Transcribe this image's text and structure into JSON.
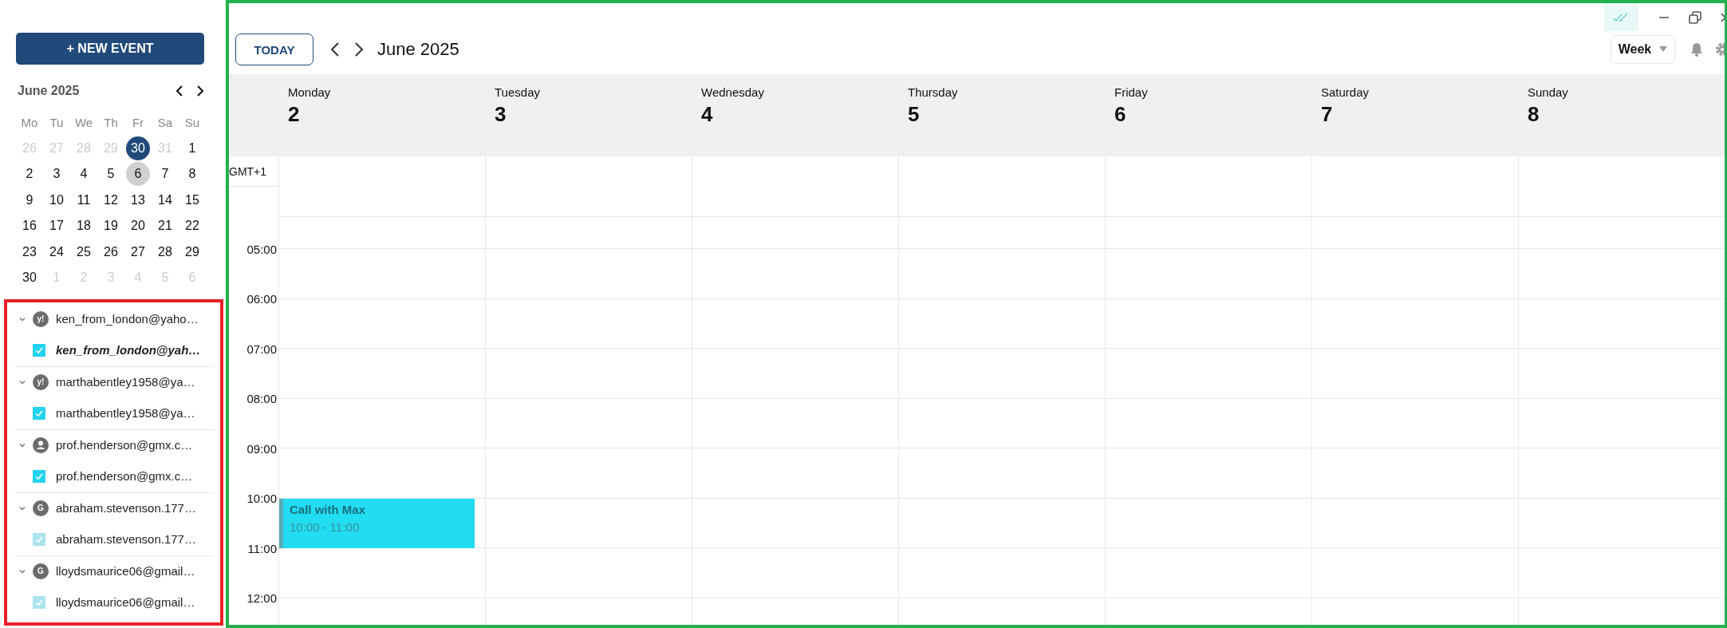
{
  "sidebar": {
    "new_event_button": "+ NEW EVENT",
    "mini_calendar": {
      "title": "June 2025",
      "weekdays": [
        "Mo",
        "Tu",
        "We",
        "Th",
        "Fr",
        "Sa",
        "Su"
      ],
      "weeks": [
        [
          {
            "day": "26",
            "in_month": false,
            "today": false,
            "selected": false
          },
          {
            "day": "27",
            "in_month": false,
            "today": false,
            "selected": false
          },
          {
            "day": "28",
            "in_month": false,
            "today": false,
            "selected": false
          },
          {
            "day": "29",
            "in_month": false,
            "today": false,
            "selected": false
          },
          {
            "day": "30",
            "in_month": true,
            "today": true,
            "selected": false
          },
          {
            "day": "31",
            "in_month": false,
            "today": false,
            "selected": false
          },
          {
            "day": "1",
            "in_month": true,
            "today": false,
            "selected": false
          }
        ],
        [
          {
            "day": "2",
            "in_month": true,
            "today": false,
            "selected": false
          },
          {
            "day": "3",
            "in_month": true,
            "today": false,
            "selected": false
          },
          {
            "day": "4",
            "in_month": true,
            "today": false,
            "selected": false
          },
          {
            "day": "5",
            "in_month": true,
            "today": false,
            "selected": false
          },
          {
            "day": "6",
            "in_month": true,
            "today": false,
            "selected": true
          },
          {
            "day": "7",
            "in_month": true,
            "today": false,
            "selected": false
          },
          {
            "day": "8",
            "in_month": true,
            "today": false,
            "selected": false
          }
        ],
        [
          {
            "day": "9",
            "in_month": true,
            "today": false,
            "selected": false
          },
          {
            "day": "10",
            "in_month": true,
            "today": false,
            "selected": false
          },
          {
            "day": "11",
            "in_month": true,
            "today": false,
            "selected": false
          },
          {
            "day": "12",
            "in_month": true,
            "today": false,
            "selected": false
          },
          {
            "day": "13",
            "in_month": true,
            "today": false,
            "selected": false
          },
          {
            "day": "14",
            "in_month": true,
            "today": false,
            "selected": false
          },
          {
            "day": "15",
            "in_month": true,
            "today": false,
            "selected": false
          }
        ],
        [
          {
            "day": "16",
            "in_month": true,
            "today": false,
            "selected": false
          },
          {
            "day": "17",
            "in_month": true,
            "today": false,
            "selected": false
          },
          {
            "day": "18",
            "in_month": true,
            "today": false,
            "selected": false
          },
          {
            "day": "19",
            "in_month": true,
            "today": false,
            "selected": false
          },
          {
            "day": "20",
            "in_month": true,
            "today": false,
            "selected": false
          },
          {
            "day": "21",
            "in_month": true,
            "today": false,
            "selected": false
          },
          {
            "day": "22",
            "in_month": true,
            "today": false,
            "selected": false
          }
        ],
        [
          {
            "day": "23",
            "in_month": true,
            "today": false,
            "selected": false
          },
          {
            "day": "24",
            "in_month": true,
            "today": false,
            "selected": false
          },
          {
            "day": "25",
            "in_month": true,
            "today": false,
            "selected": false
          },
          {
            "day": "26",
            "in_month": true,
            "today": false,
            "selected": false
          },
          {
            "day": "27",
            "in_month": true,
            "today": false,
            "selected": false
          },
          {
            "day": "28",
            "in_month": true,
            "today": false,
            "selected": false
          },
          {
            "day": "29",
            "in_month": true,
            "today": false,
            "selected": false
          }
        ],
        [
          {
            "day": "30",
            "in_month": true,
            "today": false,
            "selected": false
          },
          {
            "day": "1",
            "in_month": false,
            "today": false,
            "selected": false
          },
          {
            "day": "2",
            "in_month": false,
            "today": false,
            "selected": false
          },
          {
            "day": "3",
            "in_month": false,
            "today": false,
            "selected": false
          },
          {
            "day": "4",
            "in_month": false,
            "today": false,
            "selected": false
          },
          {
            "day": "5",
            "in_month": false,
            "today": false,
            "selected": false
          },
          {
            "day": "6",
            "in_month": false,
            "today": false,
            "selected": false
          }
        ]
      ]
    },
    "accounts": [
      {
        "name": "ken_from_london@yaho…",
        "expanded": true,
        "icon": {
          "kind": "letter",
          "letter": "y!"
        },
        "calendars": [
          {
            "name": "ken_from_london@yah…",
            "checked": true,
            "disabled": false,
            "default": true
          }
        ]
      },
      {
        "name": "marthabentley1958@ya…",
        "expanded": true,
        "icon": {
          "kind": "letter",
          "letter": "y!"
        },
        "calendars": [
          {
            "name": "marthabentley1958@ya…",
            "checked": true,
            "disabled": false,
            "default": false
          }
        ]
      },
      {
        "name": "prof.henderson@gmx.c…",
        "expanded": true,
        "icon": {
          "kind": "person"
        },
        "calendars": [
          {
            "name": "prof.henderson@gmx.c…",
            "checked": true,
            "disabled": false,
            "default": false
          }
        ]
      },
      {
        "name": "abraham.stevenson.177…",
        "expanded": true,
        "icon": {
          "kind": "letter",
          "letter": "G"
        },
        "calendars": [
          {
            "name": "abraham.stevenson.177…",
            "checked": true,
            "disabled": true,
            "default": false
          }
        ]
      },
      {
        "name": "lloydsmaurice06@gmail…",
        "expanded": true,
        "icon": {
          "kind": "letter",
          "letter": "G"
        },
        "calendars": [
          {
            "name": "lloydsmaurice06@gmail…",
            "checked": true,
            "disabled": true,
            "default": false
          }
        ]
      }
    ]
  },
  "toolbar": {
    "today_button": "TODAY",
    "title": "June 2025",
    "view_select": "Week"
  },
  "week": {
    "timezone": "GMT+1",
    "hours": [
      "05:00",
      "06:00",
      "07:00",
      "08:00",
      "09:00",
      "10:00",
      "11:00",
      "12:00"
    ],
    "days": [
      {
        "name": "Monday",
        "number": "2",
        "events": [
          {
            "title": "Call with Max",
            "time": "10:00 - 11:00"
          }
        ]
      },
      {
        "name": "Tuesday",
        "number": "3"
      },
      {
        "name": "Wednesday",
        "number": "4"
      },
      {
        "name": "Thursday",
        "number": "5"
      },
      {
        "name": "Friday",
        "number": "6"
      },
      {
        "name": "Saturday",
        "number": "7"
      },
      {
        "name": "Sunday",
        "number": "8"
      }
    ]
  }
}
